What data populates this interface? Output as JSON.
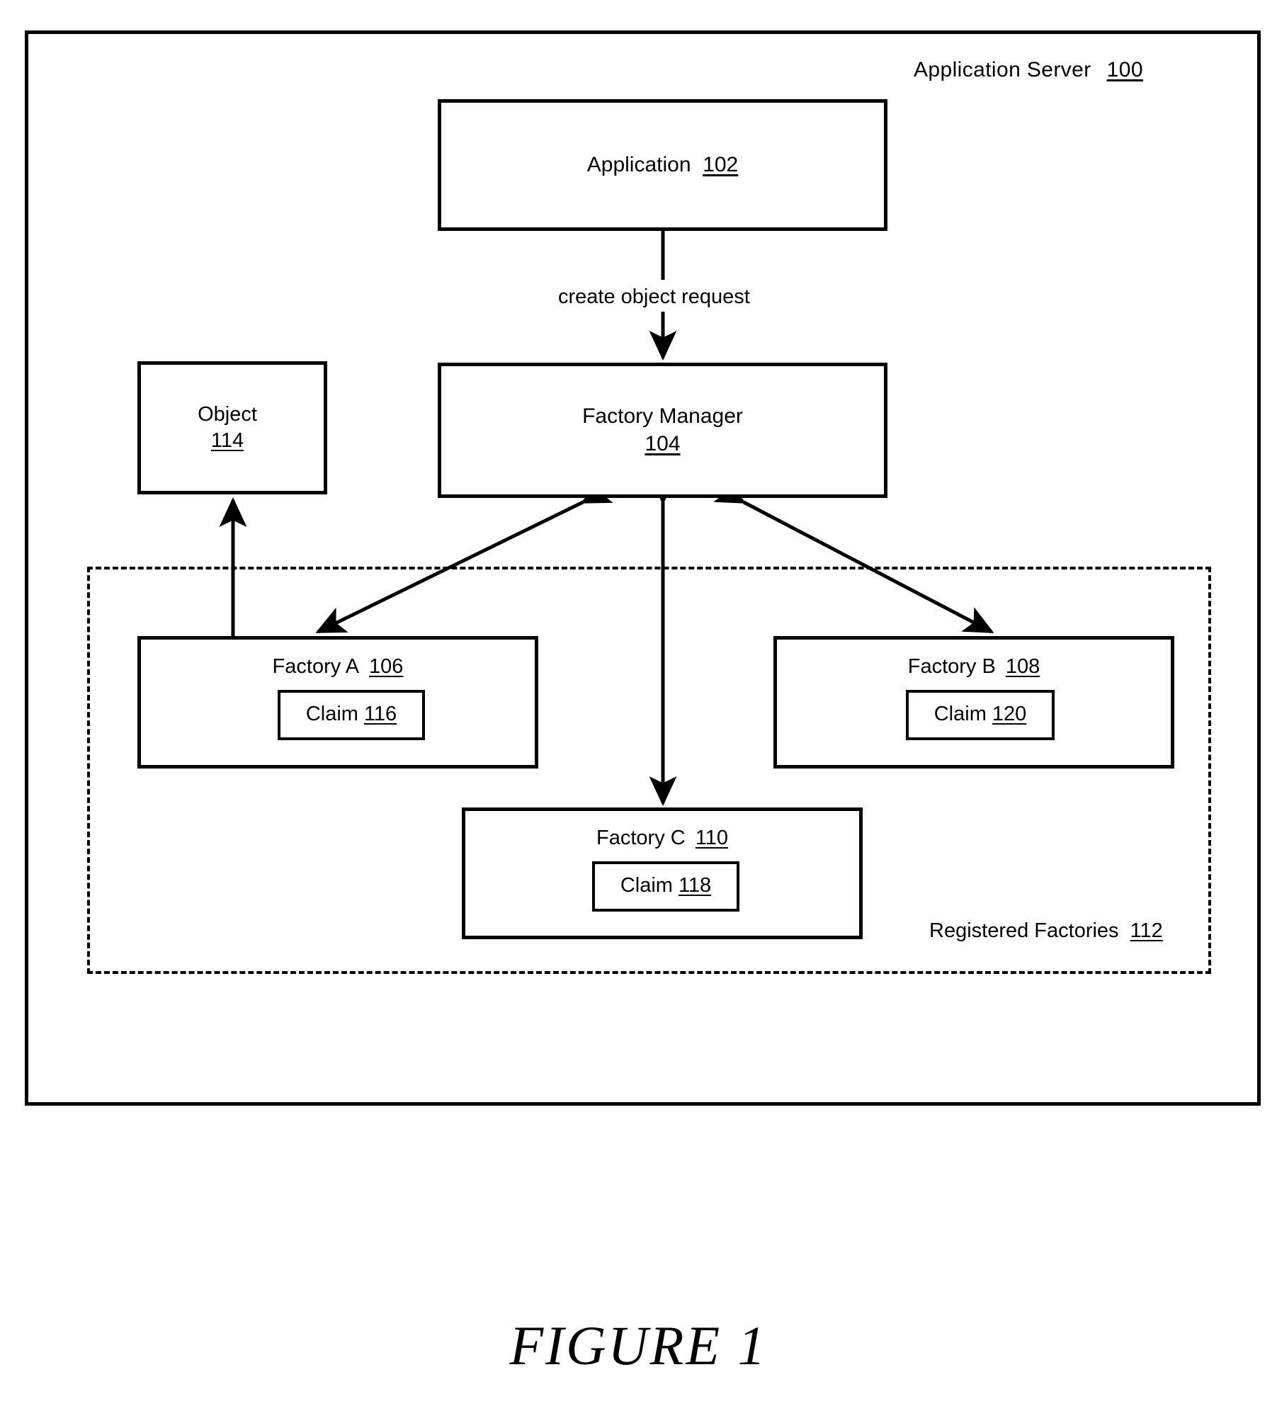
{
  "figure": {
    "caption": "FIGURE 1"
  },
  "server": {
    "label": "Application Server",
    "ref": "100"
  },
  "nodes": {
    "application": {
      "label": "Application",
      "ref": "102"
    },
    "factory_manager": {
      "label": "Factory Manager",
      "ref": "104"
    },
    "object": {
      "label": "Object",
      "ref": "114"
    }
  },
  "registered": {
    "label": "Registered Factories",
    "ref": "112"
  },
  "factories": [
    {
      "label": "Factory A",
      "ref": "106",
      "claim_label": "Claim",
      "claim_ref": "116"
    },
    {
      "label": "Factory B",
      "ref": "108",
      "claim_label": "Claim",
      "claim_ref": "120"
    },
    {
      "label": "Factory C",
      "ref": "110",
      "claim_label": "Claim",
      "claim_ref": "118"
    }
  ],
  "edges": {
    "create_object_request": "create object request"
  },
  "colors": {
    "stroke": "#000000",
    "background": "#ffffff"
  }
}
